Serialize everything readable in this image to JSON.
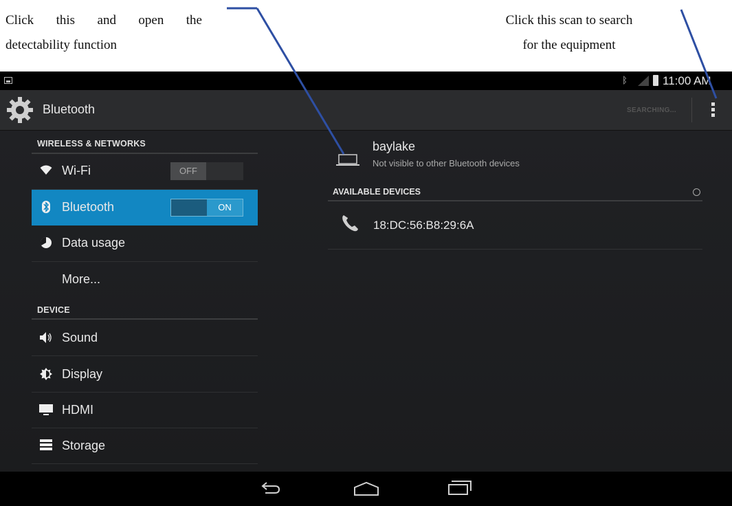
{
  "annotations": {
    "left_line1": "Click  this  and  open  the",
    "left_line2": "detectability function",
    "right_line1": "Click this scan to search",
    "right_line2": "for the equipment"
  },
  "status_bar": {
    "time": "11:00 AM"
  },
  "action_bar": {
    "title": "Bluetooth",
    "searching_label": "SEARCHING...",
    "icon": "gear-icon"
  },
  "sidebar": {
    "section_wireless": "WIRELESS & NETWORKS",
    "section_device": "DEVICE",
    "items": [
      {
        "label": "Wi-Fi",
        "icon": "wifi-icon",
        "switch": "OFF"
      },
      {
        "label": "Bluetooth",
        "icon": "bluetooth-icon",
        "switch": "ON",
        "active": true
      },
      {
        "label": "Data usage",
        "icon": "data-usage-icon"
      },
      {
        "label": "More..."
      },
      {
        "label": "Sound",
        "icon": "speaker-icon"
      },
      {
        "label": "Display",
        "icon": "brightness-icon"
      },
      {
        "label": "HDMI",
        "icon": "monitor-icon"
      },
      {
        "label": "Storage",
        "icon": "storage-icon"
      }
    ]
  },
  "detail": {
    "device_name": "baylake",
    "device_status": "Not visible to other Bluetooth devices",
    "available_header": "AVAILABLE DEVICES",
    "devices": [
      {
        "address": "18:DC:56:B8:29:6A",
        "icon": "phone-icon"
      }
    ]
  },
  "colors": {
    "accent": "#1287c2",
    "annotation_arrow": "#2e4fa3"
  }
}
